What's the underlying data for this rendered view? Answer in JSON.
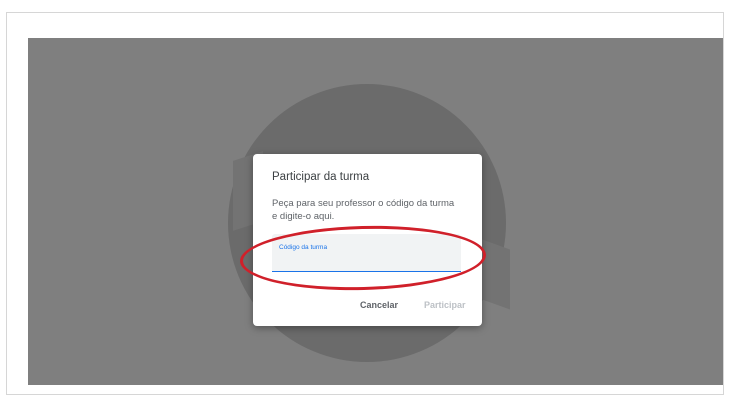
{
  "dialog": {
    "title": "Participar da turma",
    "description": "Peça para seu professor o código da turma e digite-o aqui.",
    "code_field": {
      "label": "Código da turma",
      "value": ""
    },
    "buttons": {
      "cancel": "Cancelar",
      "join": "Participar"
    }
  },
  "annotation": {
    "color": "#d0202a",
    "shape": "ellipse"
  },
  "colors": {
    "accent": "#1a73e8",
    "overlay": "#7f7f7f",
    "disabled_text": "#bdc1c6"
  }
}
